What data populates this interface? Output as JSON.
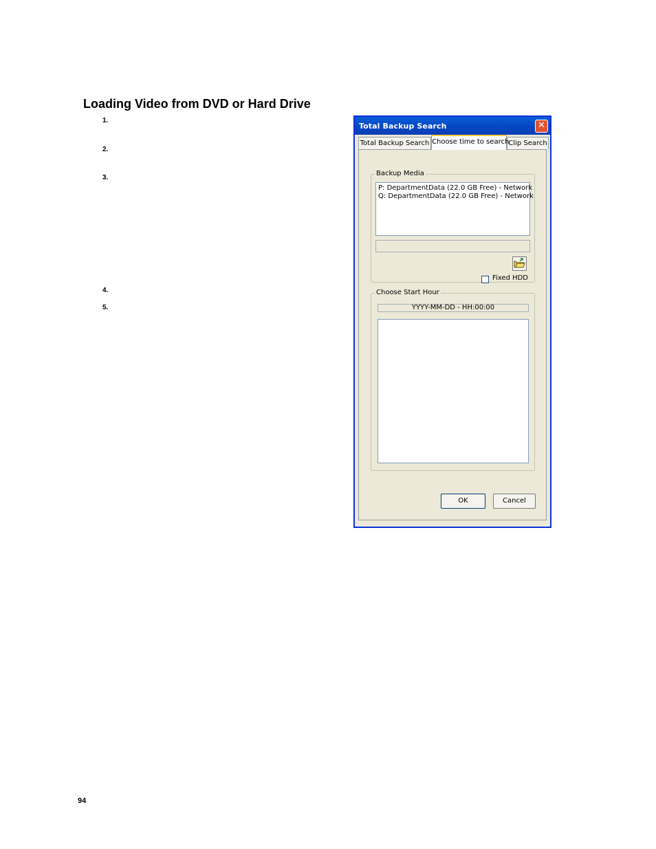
{
  "document": {
    "heading": "Loading Video from DVD or Hard Drive",
    "steps": [
      "1.",
      "2.",
      "3.",
      "4.",
      "5."
    ],
    "page_number": "94"
  },
  "dialog": {
    "title": "Total Backup Search",
    "close_label": "✕",
    "tabs": [
      {
        "label": "Total Backup Search",
        "active": false
      },
      {
        "label": "Choose time to search",
        "active": true
      },
      {
        "label": "Clip Search",
        "active": false
      }
    ],
    "backup_media": {
      "legend": "Backup Media",
      "items": [
        "P:  DepartmentData (22.0 GB Free) - Network",
        "Q:  DepartmentData (22.0 GB Free) - Network"
      ],
      "path_value": "",
      "folder_icon": "open-folder-icon",
      "fixed_hdd_label": "Fixed HDD",
      "fixed_hdd_checked": false
    },
    "start_hour": {
      "legend": "Choose Start Hour",
      "header": "YYYY-MM-DD - HH:00:00",
      "items": []
    },
    "buttons": {
      "ok": "OK",
      "cancel": "Cancel"
    },
    "colors": {
      "titlebar": "#0548c4",
      "dialog_bg": "#ece9d8",
      "close": "#e0542e",
      "active_tab_highlight": "#ffc83c"
    }
  }
}
